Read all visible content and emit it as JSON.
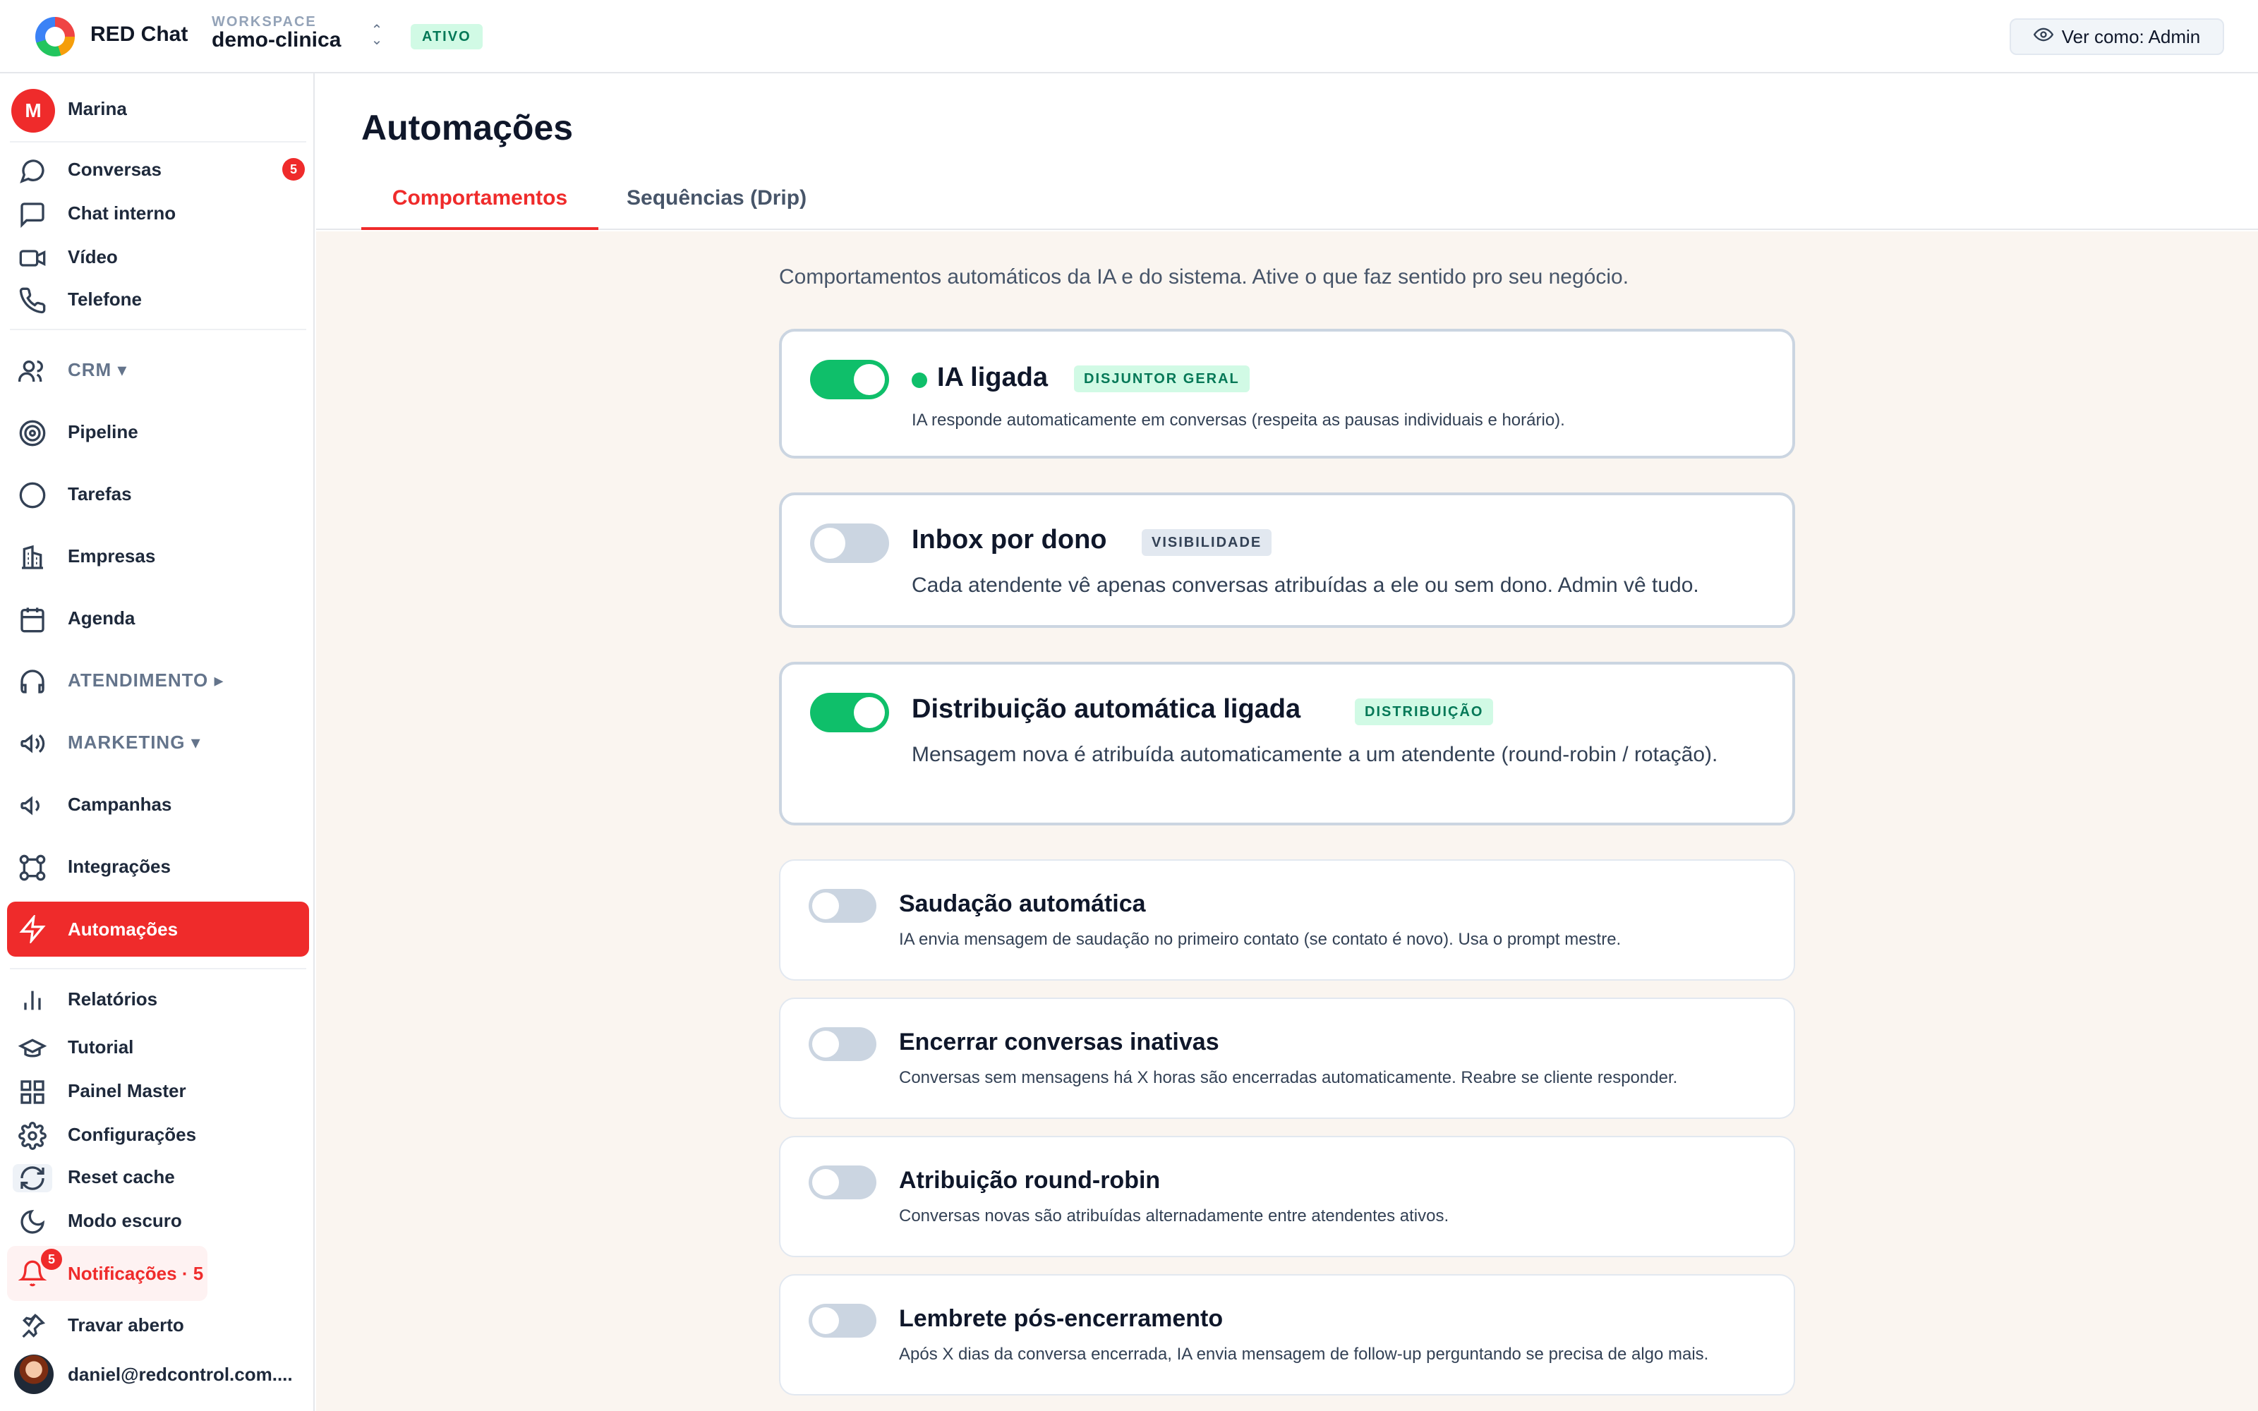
{
  "header": {
    "brand": "RED Chat",
    "workspace_label": "WORKSPACE",
    "workspace_name": "demo-clinica",
    "status_badge": "ATIVO",
    "view_as": "Ver como: Admin"
  },
  "sidebar": {
    "user_initial": "M",
    "user_name": "Marina",
    "conversas_count": "5",
    "items": {
      "conversas": "Conversas",
      "chat_interno": "Chat interno",
      "video": "Vídeo",
      "telefone": "Telefone",
      "crm": "CRM ▾",
      "pipeline": "Pipeline",
      "tarefas": "Tarefas",
      "empresas": "Empresas",
      "agenda": "Agenda",
      "atendimento": "ATENDIMENTO ▸",
      "marketing": "MARKETING ▾",
      "campanhas": "Campanhas",
      "integracoes": "Integrações",
      "automacoes": "Automações",
      "relatorios": "Relatórios",
      "tutorial": "Tutorial",
      "painel_master": "Painel Master",
      "configuracoes": "Configurações",
      "reset_cache": "Reset cache",
      "modo_escuro": "Modo escuro",
      "notificacoes": "Notificações · 5",
      "travar_aberto": "Travar aberto"
    },
    "notif_count": "5",
    "user_email": "daniel@redcontrol.com...."
  },
  "main": {
    "title": "Automações",
    "tabs": [
      "Comportamentos",
      "Sequências (Drip)"
    ],
    "intro": "Comportamentos automáticos da IA e do sistema. Ative o que faz sentido pro seu negócio.",
    "cards": [
      {
        "title": "IA ligada",
        "chip": "DISJUNTOR GERAL",
        "desc": "IA responde automaticamente em conversas (respeita as pausas individuais e horário).",
        "enabled": true
      },
      {
        "title": "Inbox por dono",
        "chip": "VISIBILIDADE",
        "desc": "Cada atendente vê apenas conversas atribuídas a ele ou sem dono. Admin vê tudo.",
        "enabled": false
      },
      {
        "title": "Distribuição automática ligada",
        "chip": "DISTRIBUIÇÃO",
        "desc": "Mensagem nova é atribuída automaticamente a um atendente (round-robin / rotação).",
        "enabled": true
      },
      {
        "title": "Saudação automática",
        "desc": "IA envia mensagem de saudação no primeiro contato (se contato é novo). Usa o prompt mestre.",
        "enabled": false
      },
      {
        "title": "Encerrar conversas inativas",
        "desc": "Conversas sem mensagens há X horas são encerradas automaticamente. Reabre se cliente responder.",
        "enabled": false
      },
      {
        "title": "Atribuição round-robin",
        "desc": "Conversas novas são atribuídas alternadamente entre atendentes ativos.",
        "enabled": false
      },
      {
        "title": "Lembrete pós-encerramento",
        "desc": "Após X dias da conversa encerrada, IA envia mensagem de follow-up perguntando se precisa de algo mais.",
        "enabled": false
      }
    ]
  }
}
